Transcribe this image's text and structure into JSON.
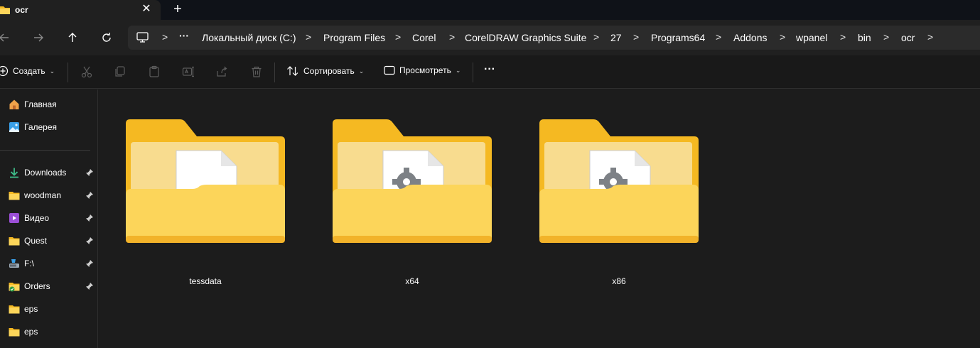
{
  "tab": {
    "title": "ocr",
    "close_glyph": "✕",
    "new_tab_glyph": "+"
  },
  "nav": {
    "back_icon": "arrow-left-icon",
    "forward_icon": "arrow-right-icon",
    "up_icon": "arrow-up-icon",
    "refresh_icon": "refresh-icon"
  },
  "address": {
    "overflow": "···",
    "separator": ">",
    "crumbs": [
      "Локальный диск (C:)",
      "Program Files",
      "Corel",
      "CorelDRAW Graphics Suite",
      "27",
      "Programs64",
      "Addons",
      "wpanel",
      "bin",
      "ocr"
    ]
  },
  "toolbar": {
    "create_label": "Создать",
    "sort_label": "Сортировать",
    "view_label": "Просмотреть",
    "more_label": "···"
  },
  "sidebar": {
    "items": [
      {
        "label": "Главная",
        "icon": "home-icon",
        "pinned": false
      },
      {
        "label": "Галерея",
        "icon": "gallery-icon",
        "pinned": false
      },
      {
        "label": "Downloads",
        "icon": "download-icon",
        "pinned": true
      },
      {
        "label": "woodman",
        "icon": "folder-icon",
        "pinned": true
      },
      {
        "label": "Видео",
        "icon": "video-icon",
        "pinned": true
      },
      {
        "label": "Quest",
        "icon": "folder-icon",
        "pinned": true
      },
      {
        "label": "F:\\",
        "icon": "drive-icon",
        "pinned": true
      },
      {
        "label": "Orders",
        "icon": "folder-sync-icon",
        "pinned": true
      },
      {
        "label": "eps",
        "icon": "folder-icon",
        "pinned": false
      },
      {
        "label": "eps",
        "icon": "folder-icon",
        "pinned": false
      }
    ]
  },
  "folders": [
    {
      "name": "tessdata",
      "icon": "folder-document-icon"
    },
    {
      "name": "x64",
      "icon": "folder-settings-icon"
    },
    {
      "name": "x86",
      "icon": "folder-settings-icon"
    }
  ],
  "colors": {
    "folder_back": "#f5b922",
    "folder_front": "#fcd55a",
    "background": "#1c1c1c",
    "accent": "#4cc2ff"
  }
}
